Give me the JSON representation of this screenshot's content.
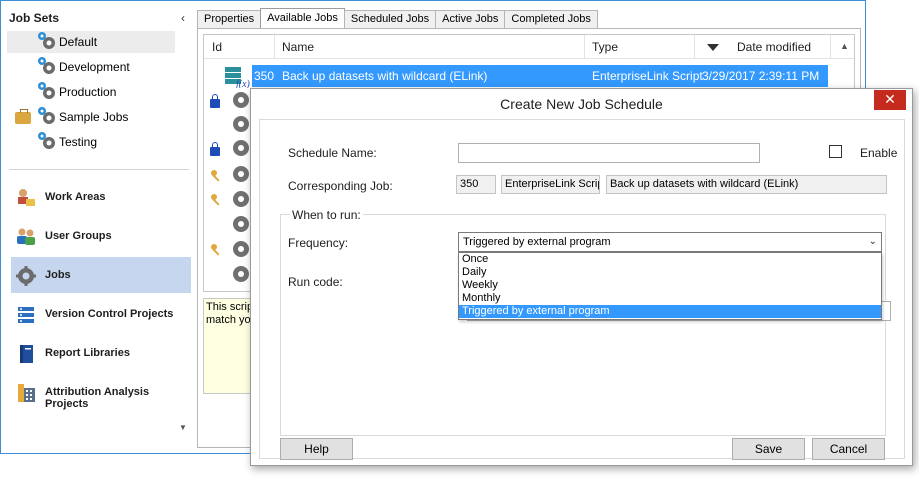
{
  "sidebar": {
    "title": "Job Sets",
    "job_sets": [
      {
        "label": "Default",
        "selected": true
      },
      {
        "label": "Development"
      },
      {
        "label": "Production"
      },
      {
        "label": "Sample Jobs"
      },
      {
        "label": "Testing"
      }
    ],
    "nav": [
      {
        "label": "Work Areas",
        "icon": "work-areas-icon"
      },
      {
        "label": "User Groups",
        "icon": "user-groups-icon"
      },
      {
        "label": "Jobs",
        "icon": "gear-icon",
        "selected": true
      },
      {
        "label": "Version Control Projects",
        "icon": "version-control-icon"
      },
      {
        "label": "Report Libraries",
        "icon": "book-icon"
      },
      {
        "label": "Attribution Analysis Projects",
        "icon": "calculator-icon"
      }
    ]
  },
  "tabs": [
    {
      "label": "Properties"
    },
    {
      "label": "Available Jobs",
      "active": true
    },
    {
      "label": "Scheduled Jobs"
    },
    {
      "label": "Active Jobs"
    },
    {
      "label": "Completed Jobs"
    }
  ],
  "grid": {
    "columns": [
      "Id",
      "Name",
      "Type",
      "Date modified"
    ],
    "selected_row": {
      "id": "350",
      "name": "Back up datasets with wildcard (ELink)",
      "type": "EnterpriseLink Script",
      "date": "3/29/2017 2:39:11 PM"
    },
    "description_lines": [
      "This script",
      "match you"
    ]
  },
  "dialog": {
    "title": "Create New Job Schedule",
    "close": "✕",
    "schedule_name_label": "Schedule Name:",
    "schedule_name_value": "",
    "enable_label": "Enable",
    "corresponding_job_label": "Corresponding Job:",
    "job_id": "350",
    "job_type": "EnterpriseLink Script",
    "job_name": "Back up datasets with wildcard (ELink)",
    "when_to_run_label": "When to run:",
    "frequency_label": "Frequency:",
    "frequency_value": "Triggered by external program",
    "frequency_options": [
      "Once",
      "Daily",
      "Weekly",
      "Monthly",
      "Triggered by external program"
    ],
    "run_code_label": "Run code:",
    "help_label": "Help",
    "save_label": "Save",
    "cancel_label": "Cancel"
  },
  "colors": {
    "window_border": "#3c8fd6",
    "selection": "#3399ff",
    "nav_selected": "#c5d6ee",
    "close_button": "#c42b1c"
  }
}
